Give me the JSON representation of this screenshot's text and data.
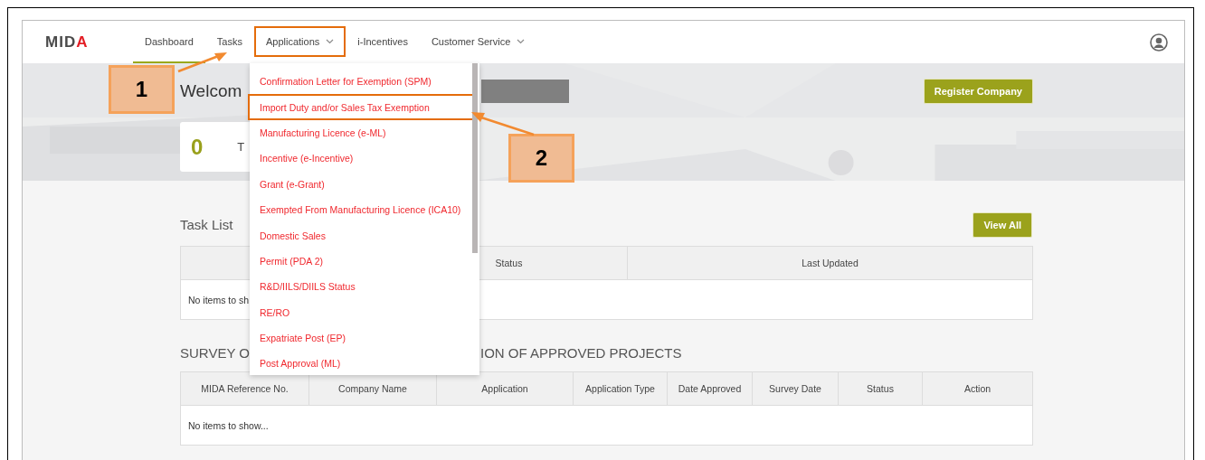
{
  "logo": "MIDA",
  "nav": [
    {
      "label": "Dashboard",
      "selected": true,
      "dropdown": false
    },
    {
      "label": "Tasks",
      "selected": false,
      "dropdown": false
    },
    {
      "label": "Applications",
      "selected": false,
      "dropdown": true,
      "annotated": true
    },
    {
      "label": "i-Incentives",
      "selected": false,
      "dropdown": false
    },
    {
      "label": "Customer Service",
      "selected": false,
      "dropdown": true
    }
  ],
  "hero": {
    "welcome": "Welcom",
    "register_button": "Register Company",
    "stat": {
      "count": "0",
      "label": "T"
    }
  },
  "task_list": {
    "title": "Task List",
    "view_all": "View All",
    "columns": [
      "Status",
      "Last Updated"
    ],
    "empty": "No items to sh"
  },
  "survey": {
    "title_left": "SURVEY O",
    "title_right": "ION OF APPROVED PROJECTS",
    "columns": [
      "MIDA Reference No.",
      "Company Name",
      "Application",
      "Application Type",
      "Date Approved",
      "Survey Date",
      "Status",
      "Action"
    ],
    "empty": "No items to show..."
  },
  "applications_menu": [
    {
      "label": "Confirmation Letter for Exemption (SPM)",
      "annotated": false
    },
    {
      "label": "Import Duty and/or Sales Tax Exemption",
      "annotated": true
    },
    {
      "label": "Manufacturing Licence (e-ML)",
      "annotated": false
    },
    {
      "label": "Incentive (e-Incentive)",
      "annotated": false
    },
    {
      "label": "Grant (e-Grant)",
      "annotated": false
    },
    {
      "label": "Exempted From Manufacturing Licence (ICA10)",
      "annotated": false
    },
    {
      "label": "Domestic Sales",
      "annotated": false
    },
    {
      "label": "Permit (PDA 2)",
      "annotated": false
    },
    {
      "label": "R&D/IILS/DIILS Status",
      "annotated": false
    },
    {
      "label": "RE/RO",
      "annotated": false
    },
    {
      "label": "Expatriate Post (EP)",
      "annotated": false
    },
    {
      "label": "Post Approval (ML)",
      "annotated": false
    }
  ],
  "callouts": [
    "1",
    "2"
  ]
}
